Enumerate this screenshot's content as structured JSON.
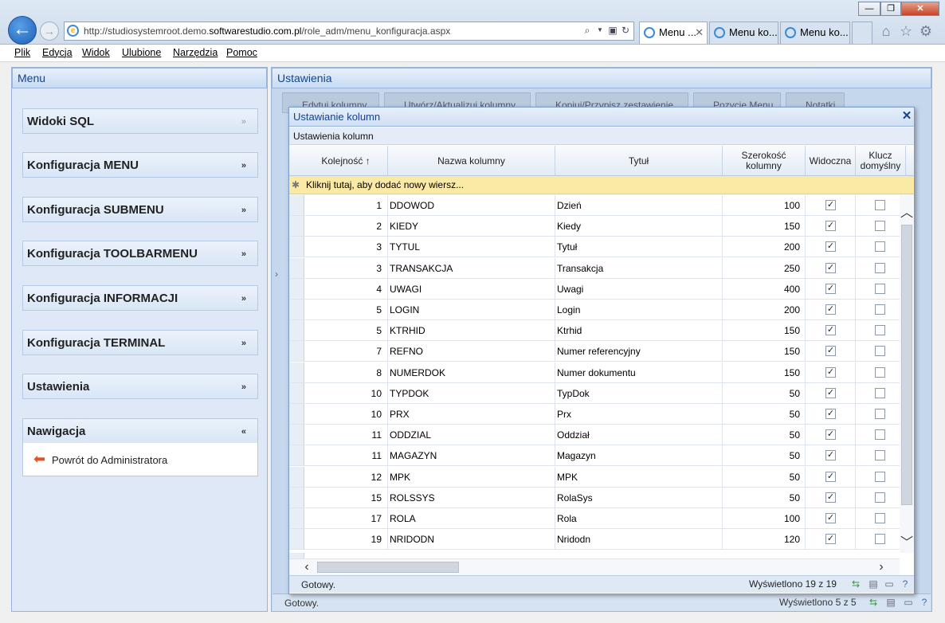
{
  "browser": {
    "url_prefix": "http://studiosystemroot.demo.",
    "url_domain": "softwarestudio.com.pl",
    "url_suffix": "/role_adm/menu_konfiguracja.aspx",
    "tabs": [
      {
        "label": "Menu ..."
      },
      {
        "label": "Menu ko..."
      },
      {
        "label": "Menu ko..."
      }
    ],
    "menu": [
      "Plik",
      "Edycja",
      "Widok",
      "Ulubione",
      "Narzędzia",
      "Pomoc"
    ]
  },
  "left": {
    "title": "Menu",
    "sections": [
      "Widoki SQL",
      "Konfiguracja MENU",
      "Konfiguracja SUBMENU",
      "Konfiguracja TOOLBARMENU",
      "Konfiguracja INFORMACJI",
      "Konfiguracja TERMINAL",
      "Ustawienia",
      "Nawigacja"
    ],
    "nav_link": "Powrót do Administratora"
  },
  "right": {
    "title": "Ustawienia",
    "toolbar": [
      "Edytuj kolumny",
      "Utwórz/Aktualizuj kolumny",
      "Kopiuj/Przypisz zestawienie",
      "Pozycje Menu",
      "Notatki"
    ],
    "status": "Gotowy.",
    "count": "Wyświetlono 5 z 5"
  },
  "dialog": {
    "title": "Ustawianie kolumn",
    "subtitle": "Ustawienia kolumn",
    "headers": {
      "order": "Kolejność",
      "name": "Nazwa kolumny",
      "title": "Tytuł",
      "width": "Szerokość kolumny",
      "visible": "Widoczna",
      "key": "Klucz domyślny"
    },
    "new_row": "Kliknij tutaj, aby dodać nowy wiersz...",
    "rows": [
      {
        "order": "1",
        "name": "DDOWOD",
        "title": "Dzień",
        "width": "100",
        "visible": true,
        "key": false
      },
      {
        "order": "2",
        "name": "KIEDY",
        "title": "Kiedy",
        "width": "150",
        "visible": true,
        "key": false
      },
      {
        "order": "3",
        "name": "TYTUL",
        "title": "Tytuł",
        "width": "200",
        "visible": true,
        "key": false
      },
      {
        "order": "3",
        "name": "TRANSAKCJA",
        "title": "Transakcja",
        "width": "250",
        "visible": true,
        "key": false
      },
      {
        "order": "4",
        "name": "UWAGI",
        "title": "Uwagi",
        "width": "400",
        "visible": true,
        "key": false
      },
      {
        "order": "5",
        "name": "LOGIN",
        "title": "Login",
        "width": "200",
        "visible": true,
        "key": false
      },
      {
        "order": "5",
        "name": "KTRHID",
        "title": "Ktrhid",
        "width": "150",
        "visible": true,
        "key": false
      },
      {
        "order": "7",
        "name": "REFNO",
        "title": "Numer referencyjny",
        "width": "150",
        "visible": true,
        "key": false
      },
      {
        "order": "8",
        "name": "NUMERDOK",
        "title": "Numer dokumentu",
        "width": "150",
        "visible": true,
        "key": false
      },
      {
        "order": "10",
        "name": "TYPDOK",
        "title": "TypDok",
        "width": "50",
        "visible": true,
        "key": false
      },
      {
        "order": "10",
        "name": "PRX",
        "title": "Prx",
        "width": "50",
        "visible": true,
        "key": false
      },
      {
        "order": "11",
        "name": "ODDZIAL",
        "title": "Oddział",
        "width": "50",
        "visible": true,
        "key": false
      },
      {
        "order": "11",
        "name": "MAGAZYN",
        "title": "Magazyn",
        "width": "50",
        "visible": true,
        "key": false
      },
      {
        "order": "12",
        "name": "MPK",
        "title": "MPK",
        "width": "50",
        "visible": true,
        "key": false
      },
      {
        "order": "15",
        "name": "ROLSSYS",
        "title": "RolaSys",
        "width": "50",
        "visible": true,
        "key": false
      },
      {
        "order": "17",
        "name": "ROLA",
        "title": "Rola",
        "width": "100",
        "visible": true,
        "key": false
      },
      {
        "order": "19",
        "name": "NRIDODN",
        "title": "Nridodn",
        "width": "120",
        "visible": true,
        "key": false
      }
    ],
    "status": "Gotowy.",
    "count": "Wyświetlono 19 z 19"
  }
}
